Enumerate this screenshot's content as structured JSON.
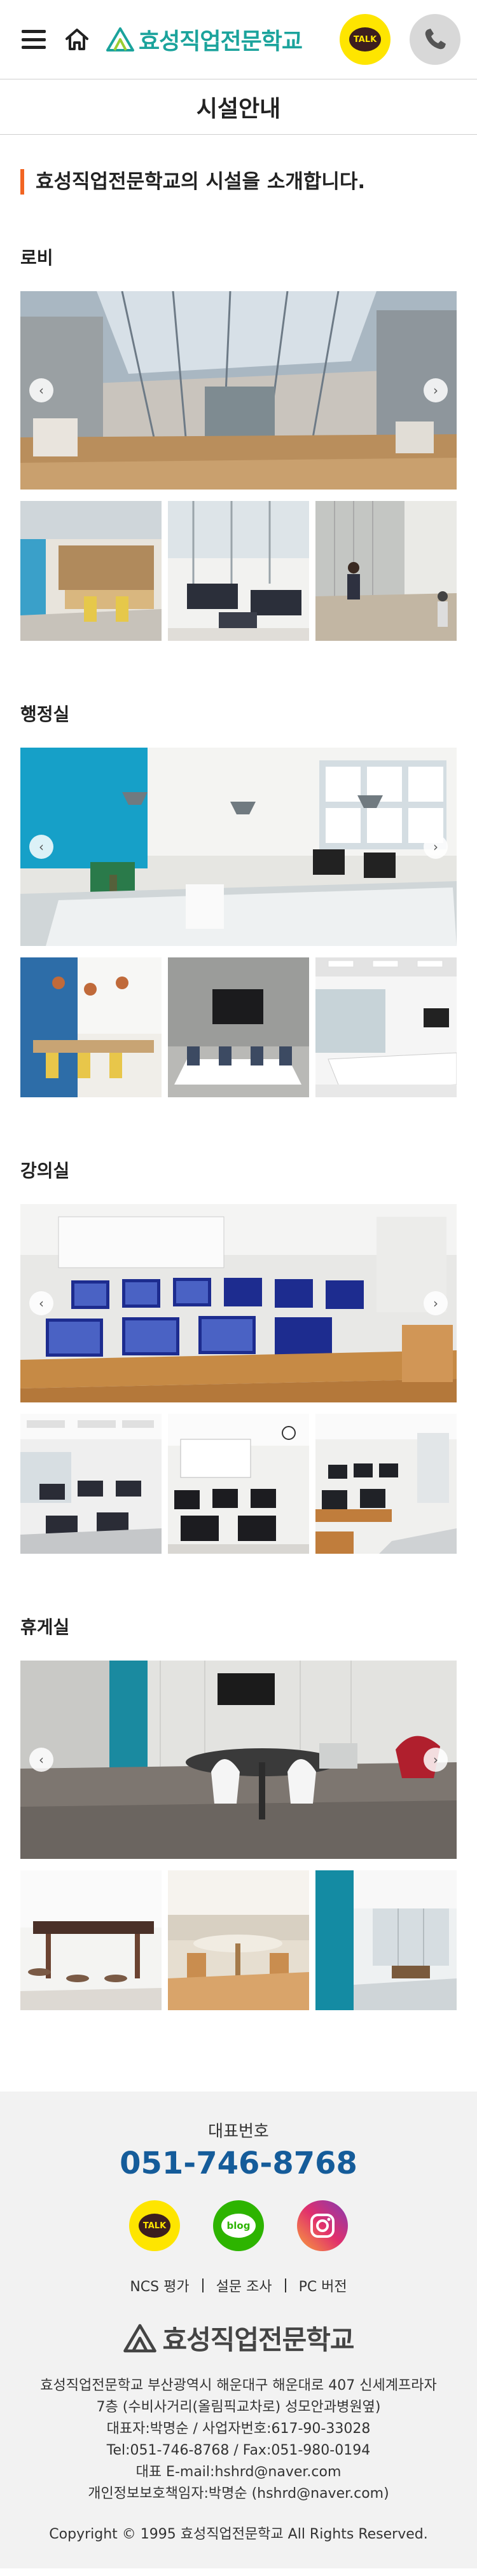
{
  "header": {
    "logo_text": "효성직업전문학교",
    "talk_label": "TALK"
  },
  "page_title": "시설안내",
  "intro": "효성직업전문학교의 시설을 소개합니다.",
  "sections": [
    {
      "title": "로비"
    },
    {
      "title": "행정실"
    },
    {
      "title": "강의실"
    },
    {
      "title": "휴게실"
    }
  ],
  "footer": {
    "rep_label": "대표번호",
    "rep_phone": "051-746-8768",
    "social": {
      "talk": "TALK",
      "blog": "blog"
    },
    "links": [
      "NCS 평가",
      "설문 조사",
      "PC 버전"
    ],
    "logo_text": "효성직업전문학교",
    "info_lines": [
      "효성직업전문학교 부산광역시 해운대구 해운대로 407 신세계프라자",
      "7층 (수비사거리(올림픽교차로) 성모안과병원옆)",
      "대표자:박명순 / 사업자번호:617-90-33028",
      "Tel:051-746-8768 / Fax:051-980-0194",
      "대표 E-mail:hshrd@naver.com",
      "개인정보보호책임자:박명순 (hshrd@naver.com)"
    ],
    "copyright": "Copyright © 1995 효성직업전문학교 All Rights Reserved."
  },
  "colors": {
    "brand_teal": "#1ba39c",
    "accent_orange": "#f26522",
    "phone_blue": "#155c9a",
    "kakao_yellow": "#fee500",
    "blog_green": "#2db400"
  },
  "icons": [
    "menu-icon",
    "home-icon",
    "kakaotalk-icon",
    "phone-icon",
    "chevron-left-icon",
    "chevron-right-icon",
    "blog-icon",
    "instagram-icon"
  ]
}
